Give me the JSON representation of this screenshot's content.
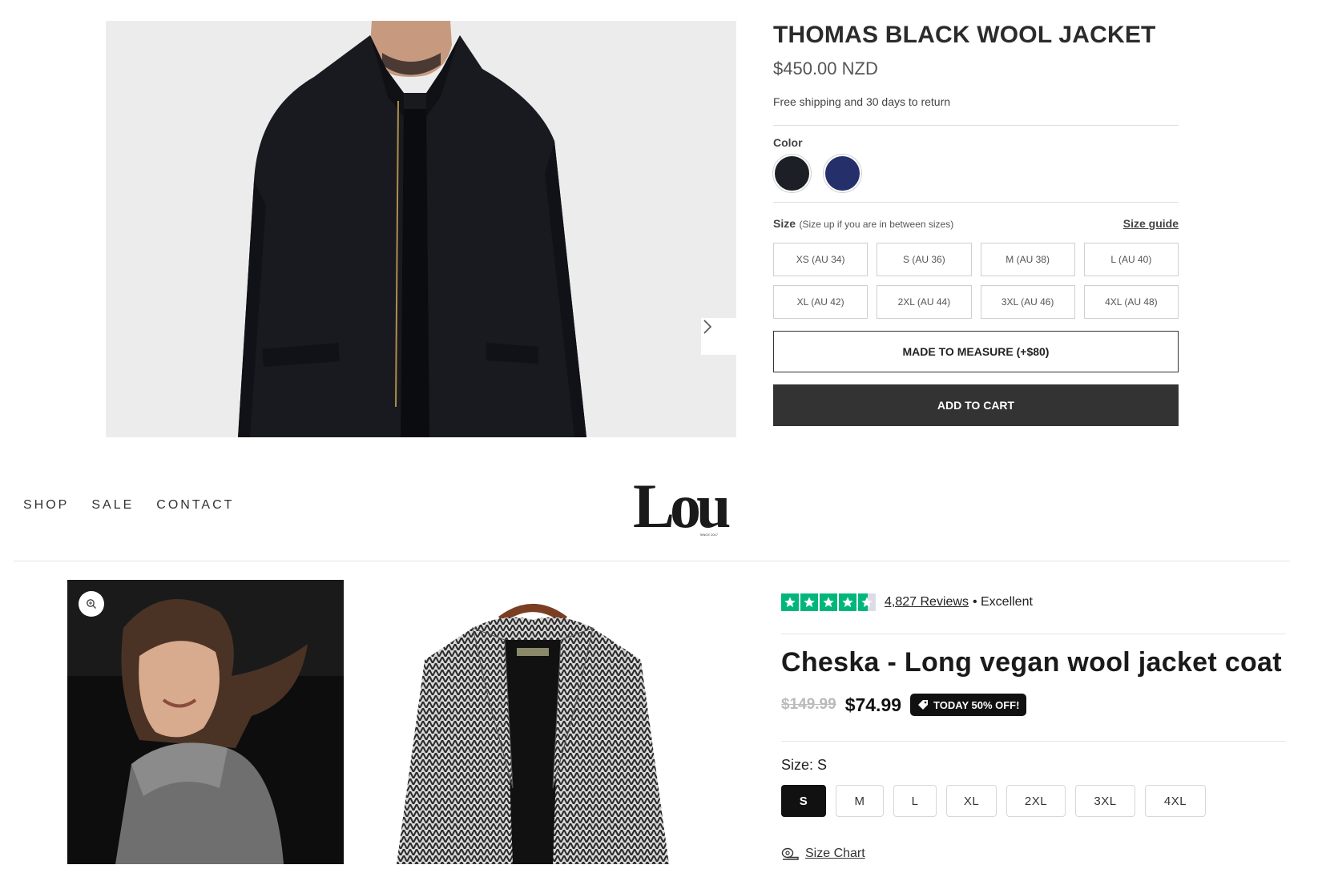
{
  "product_top": {
    "title": "THOMAS BLACK WOOL JACKET",
    "price": "$450.00 NZD",
    "shipping": "Free shipping and 30 days to return",
    "color_label": "Color",
    "colors": [
      {
        "name": "Black",
        "hex": "#1c1f26"
      },
      {
        "name": "Navy",
        "hex": "#25306b"
      }
    ],
    "size_label": "Size",
    "size_note": "(Size up if you are in between sizes)",
    "size_guide": "Size guide",
    "sizes": [
      "XS (AU 34)",
      "S (AU 36)",
      "M (AU 38)",
      "L (AU 40)",
      "XL (AU 42)",
      "2XL (AU 44)",
      "3XL (AU 46)",
      "4XL (AU 48)"
    ],
    "made_to_measure": "MADE TO MEASURE (+$80)",
    "add_to_cart": "ADD TO CART"
  },
  "header": {
    "nav": [
      "SHOP",
      "SALE",
      "CONTACT"
    ],
    "logo": "Lou",
    "logo_tagline": "SINCE 2017"
  },
  "product_bottom": {
    "reviews_count": "4,827 Reviews",
    "rating_text": "• Excellent",
    "title": "Cheska - Long vegan wool jacket coat",
    "old_price": "$149.99",
    "new_price": "$74.99",
    "badge": "TODAY 50% OFF!",
    "size_label": "Size: S",
    "sizes": [
      "S",
      "M",
      "L",
      "XL",
      "2XL",
      "3XL",
      "4XL"
    ],
    "selected_size": "S",
    "size_chart": "Size Chart"
  },
  "colors": {
    "trustpilot_green": "#00b67a",
    "button_dark": "#333333",
    "badge_black": "#111111"
  }
}
